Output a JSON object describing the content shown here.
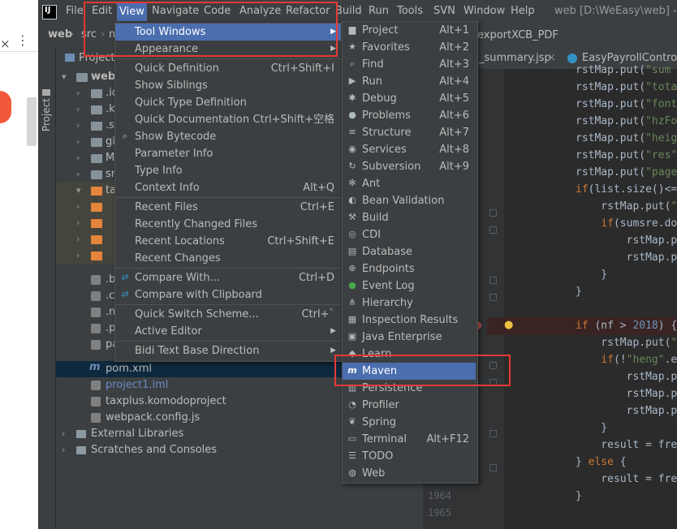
{
  "browser": {
    "close_glyph": "×",
    "kebab_glyph": "⋮"
  },
  "app": {
    "logo_text": "IJ",
    "title": "web [D:\\WeEasy\\web] - ..."
  },
  "menubar": [
    "File",
    "Edit",
    "View",
    "Navigate",
    "Code",
    "Analyze",
    "Refactor",
    "Build",
    "Run",
    "Tools",
    "SVN",
    "Window",
    "Help"
  ],
  "nav": {
    "items": [
      "web",
      "src",
      "m"
    ],
    "tab_right": "exportXCB_PDF"
  },
  "project_panel": {
    "tab_label": "Project",
    "header": "Project",
    "rows": [
      {
        "text": "web",
        "kind": "folder-root"
      },
      {
        "text": ".id",
        "kind": "folder"
      },
      {
        "text": ".k",
        "kind": "folder"
      },
      {
        "text": ".se",
        "kind": "folder"
      },
      {
        "text": "gi",
        "kind": "folder"
      },
      {
        "text": "M",
        "kind": "folder"
      },
      {
        "text": "sr",
        "kind": "folder"
      },
      {
        "text": "ta",
        "kind": "folder-open"
      },
      {
        "text": "",
        "kind": "folder"
      },
      {
        "text": "",
        "kind": "folder"
      },
      {
        "text": "",
        "kind": "folder"
      },
      {
        "text": "",
        "kind": "folder"
      },
      {
        "text": ".b",
        "kind": "file"
      },
      {
        "text": ".cl",
        "kind": "file"
      },
      {
        "text": ".m",
        "kind": "file"
      },
      {
        "text": ".p",
        "kind": "file"
      },
      {
        "text": "pa",
        "kind": "file"
      },
      {
        "text": "pom.xml",
        "kind": "file"
      },
      {
        "text": "project1.iml",
        "kind": "file"
      },
      {
        "text": "taxplus.komodoproject",
        "kind": "file"
      },
      {
        "text": "webpack.config.js",
        "kind": "file"
      },
      {
        "text": "External Libraries",
        "kind": "lib"
      },
      {
        "text": "Scratches and Consoles",
        "kind": "scratch"
      }
    ]
  },
  "editor": {
    "tabs": [
      "_summary.jsp",
      "EasyPayrollControlle"
    ],
    "line_numbers": [
      "1964",
      "1965"
    ],
    "code": [
      "rstMap.put(\"sum",
      "rstMap.put(\"tota",
      "rstMap.put(\"font",
      "rstMap.put(\"hzFo",
      "rstMap.put(\"heig",
      "rstMap.put(\"res\"",
      "rstMap.put(\"page",
      "if(list.size()<=",
      "    rstMap.put(\"",
      "    if(sumsre.do",
      "        rstMap.p",
      "        rstMap.p",
      "    }",
      "}",
      "",
      "if (nf > 2018) {",
      "    rstMap.put(\"",
      "    if(!\"heng\".e",
      "        rstMap.p",
      "        rstMap.p",
      "        rstMap.p",
      "    }",
      "    result = fre",
      "} else {",
      "    result = fre",
      "}"
    ]
  },
  "view_menu": {
    "items": [
      {
        "label": "Tool Windows",
        "shortcut": "",
        "submenu": true,
        "selected": true
      },
      {
        "label": "Appearance",
        "shortcut": "",
        "submenu": true
      },
      {
        "sep": true
      },
      {
        "label": "Quick Definition",
        "shortcut": "Ctrl+Shift+I"
      },
      {
        "label": "Show Siblings",
        "shortcut": ""
      },
      {
        "label": "Quick Type Definition",
        "shortcut": ""
      },
      {
        "label": "Quick Documentation",
        "shortcut": "Ctrl+Shift+空格"
      },
      {
        "label": "Show Bytecode",
        "shortcut": ""
      },
      {
        "label": "Parameter Info",
        "shortcut": ""
      },
      {
        "label": "Type Info",
        "shortcut": ""
      },
      {
        "label": "Context Info",
        "shortcut": "Alt+Q"
      },
      {
        "sep": true
      },
      {
        "label": "Recent Files",
        "shortcut": "Ctrl+E"
      },
      {
        "label": "Recently Changed Files",
        "shortcut": ""
      },
      {
        "label": "Recent Locations",
        "shortcut": "Ctrl+Shift+E"
      },
      {
        "label": "Recent Changes",
        "shortcut": ""
      },
      {
        "sep": true
      },
      {
        "label": "Compare With...",
        "shortcut": "Ctrl+D"
      },
      {
        "label": "Compare with Clipboard",
        "shortcut": ""
      },
      {
        "sep": true
      },
      {
        "label": "Quick Switch Scheme...",
        "shortcut": "Ctrl+`"
      },
      {
        "label": "Active Editor",
        "shortcut": "",
        "submenu": true
      },
      {
        "sep": true
      },
      {
        "label": "Bidi Text Base Direction",
        "shortcut": "",
        "submenu": true
      }
    ]
  },
  "tool_windows_menu": {
    "items": [
      {
        "label": "Project",
        "shortcut": "Alt+1",
        "icon": "folder-icon"
      },
      {
        "label": "Favorites",
        "shortcut": "Alt+2",
        "icon": "star-icon"
      },
      {
        "label": "Find",
        "shortcut": "Alt+3",
        "icon": "search-icon"
      },
      {
        "label": "Run",
        "shortcut": "Alt+4",
        "icon": "run-icon"
      },
      {
        "label": "Debug",
        "shortcut": "Alt+5",
        "icon": "bug-icon"
      },
      {
        "label": "Problems",
        "shortcut": "Alt+6",
        "icon": "problems-icon"
      },
      {
        "label": "Structure",
        "shortcut": "Alt+7",
        "icon": "structure-icon"
      },
      {
        "label": "Services",
        "shortcut": "Alt+8",
        "icon": "services-icon"
      },
      {
        "label": "Subversion",
        "shortcut": "Alt+9",
        "icon": "subversion-icon"
      },
      {
        "label": "Ant",
        "shortcut": "",
        "icon": "ant-icon"
      },
      {
        "label": "Bean Validation",
        "shortcut": "",
        "icon": "bean-icon"
      },
      {
        "label": "Build",
        "shortcut": "",
        "icon": "hammer-icon"
      },
      {
        "label": "CDI",
        "shortcut": "",
        "icon": "cdi-icon"
      },
      {
        "label": "Database",
        "shortcut": "",
        "icon": "database-icon"
      },
      {
        "label": "Endpoints",
        "shortcut": "",
        "icon": "endpoints-icon"
      },
      {
        "label": "Event Log",
        "shortcut": "",
        "icon": "event-log-icon"
      },
      {
        "label": "Hierarchy",
        "shortcut": "",
        "icon": "hierarchy-icon"
      },
      {
        "label": "Inspection Results",
        "shortcut": "",
        "icon": "inspection-icon"
      },
      {
        "label": "Java Enterprise",
        "shortcut": "",
        "icon": "java-enterprise-icon"
      },
      {
        "label": "Learn",
        "shortcut": "",
        "icon": "learn-icon"
      },
      {
        "label": "Maven",
        "shortcut": "",
        "icon": "maven-icon",
        "selected": true
      },
      {
        "label": "Persistence",
        "shortcut": "",
        "icon": "persistence-icon"
      },
      {
        "label": "Profiler",
        "shortcut": "",
        "icon": "profiler-icon"
      },
      {
        "label": "Spring",
        "shortcut": "",
        "icon": "spring-icon"
      },
      {
        "label": "Terminal",
        "shortcut": "Alt+F12",
        "icon": "terminal-icon"
      },
      {
        "label": "TODO",
        "shortcut": "",
        "icon": "todo-icon"
      },
      {
        "label": "Web",
        "shortcut": "",
        "icon": "web-icon"
      }
    ]
  },
  "colors": {
    "selection": "#4b6eaf",
    "highlight_box": "#e53935",
    "keyword": "#cc7832",
    "string": "#6a8759"
  }
}
